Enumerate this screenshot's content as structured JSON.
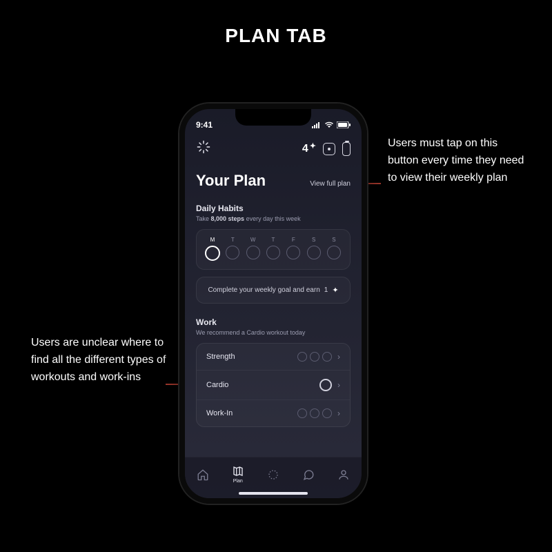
{
  "page_title": "PLAN TAB",
  "annotations": {
    "right": "Users must tap on this button every time they need to view their weekly plan",
    "left": "Users are unclear where to find all the different types of workouts and work-ins"
  },
  "status": {
    "time": "9:41"
  },
  "topbar": {
    "streak": "4"
  },
  "header": {
    "title": "Your Plan",
    "view_full": "View full plan"
  },
  "habits": {
    "title": "Daily Habits",
    "sub_pre": "Take ",
    "sub_bold": "8,000 steps",
    "sub_post": " every day this week",
    "days": [
      "M",
      "T",
      "W",
      "T",
      "F",
      "S",
      "S"
    ],
    "active_index": 0
  },
  "goal": {
    "text": "Complete your weekly goal and earn",
    "reward": "1"
  },
  "work": {
    "title": "Work",
    "sub": "We recommend a Cardio workout today",
    "rows": [
      {
        "label": "Strength",
        "dots": 3,
        "highlight": false
      },
      {
        "label": "Cardio",
        "dots": 1,
        "highlight": true
      },
      {
        "label": "Work-In",
        "dots": 3,
        "highlight": false
      }
    ]
  },
  "tabs": {
    "plan": "Plan"
  }
}
